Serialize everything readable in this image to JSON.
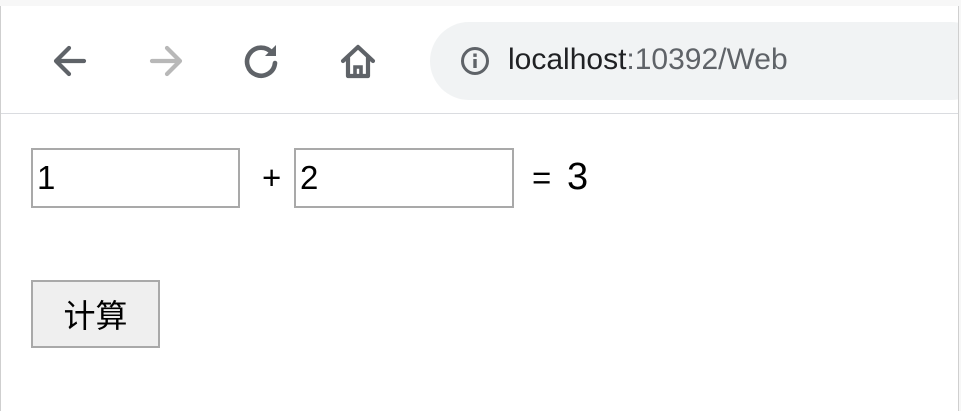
{
  "browser": {
    "url_host": "localhost",
    "url_rest": ":10392/Web",
    "icons": {
      "back": "arrow-left-icon",
      "forward": "arrow-right-icon",
      "reload": "reload-icon",
      "home": "home-icon",
      "site_info": "info-icon"
    },
    "forward_enabled": false
  },
  "calculator": {
    "operand_a": "1",
    "operand_b": "2",
    "plus_label": "+",
    "equals_label": "=",
    "result": "3",
    "button_label": "计算"
  },
  "colors": {
    "toolbar_icon": "#5f6368",
    "toolbar_icon_disabled": "#b8b8b8",
    "omnibox_bg": "#f1f3f4",
    "button_bg": "#efefef",
    "input_border": "#a9a9a9"
  }
}
